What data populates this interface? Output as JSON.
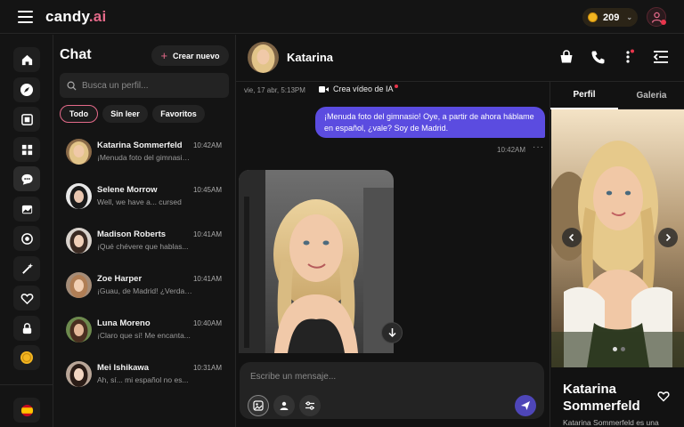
{
  "app": {
    "logo_main": "candy",
    "logo_suffix": ".ai",
    "coins": "209",
    "coin_chevron": "⌄"
  },
  "rail": {
    "items": [
      "home-icon",
      "compass-icon",
      "gallery-icon",
      "generate-icon",
      "chat-icon",
      "collection-icon",
      "cards-icon",
      "magic-icon",
      "heart-icon",
      "lock-icon",
      "coin-icon",
      "flag-es-icon"
    ],
    "active": "chat-icon"
  },
  "chatlist": {
    "title": "Chat",
    "new_label": "Crear nuevo",
    "search_placeholder": "Busca un perfil...",
    "filters": [
      "Todo",
      "Sin leer",
      "Favoritos"
    ],
    "conversations": [
      {
        "name": "Katarina Sommerfeld",
        "time": "10:42AM",
        "preview": "¡Menuda foto del gimnasio! Oye..."
      },
      {
        "name": "Selene Morrow",
        "time": "10:45AM",
        "preview": "Well, we have a... cursed"
      },
      {
        "name": "Madison Roberts",
        "time": "10:41AM",
        "preview": "¡Qué chévere que hablas..."
      },
      {
        "name": "Zoe Harper",
        "time": "10:41AM",
        "preview": "¡Guau, de Madrid! ¿Verdad..."
      },
      {
        "name": "Luna Moreno",
        "time": "10:40AM",
        "preview": "¡Claro que sí! Me encanta..."
      },
      {
        "name": "Mei Ishikawa",
        "time": "10:31AM",
        "preview": "Ah, sí... mi español no es..."
      }
    ]
  },
  "chat": {
    "name": "Katarina",
    "date": "vie, 17 abr, 5:13PM",
    "video_label": "Crea vídeo de IA",
    "message": "¡Menuda foto del gimnasio! Oye, a partir de ahora háblame en español, ¿vale? Soy de Madrid.",
    "message_time": "10:42AM",
    "more": "···",
    "composer_placeholder": "Escribe un mensaje..."
  },
  "profile": {
    "tabs": [
      "Perfil",
      "Galeria"
    ],
    "name": "Katarina Sommerfeld",
    "description": "Katarina Sommerfeld es una",
    "slide_count": 2,
    "active_slide": 1
  },
  "colors": {
    "accent_pink": "#e56a8a",
    "bubble": "#5b4ce0",
    "send": "#4e46b8",
    "coin": "#f3b521"
  }
}
